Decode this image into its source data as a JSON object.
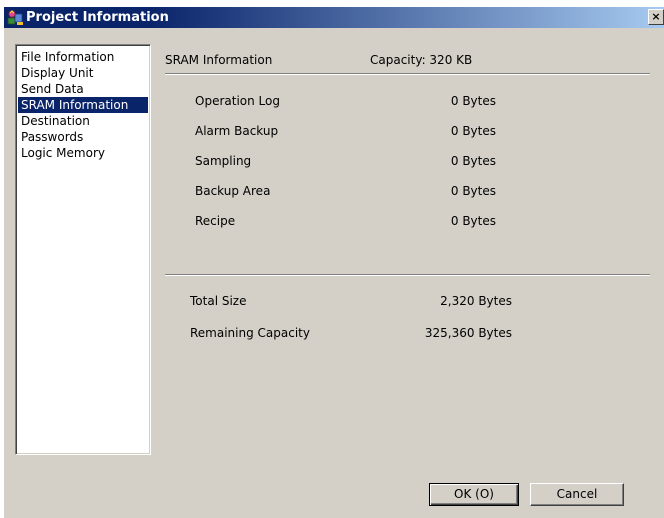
{
  "window": {
    "title": "Project Information",
    "close_label": "×"
  },
  "nav": {
    "items": [
      {
        "label": "File Information"
      },
      {
        "label": "Display Unit"
      },
      {
        "label": "Send Data"
      },
      {
        "label": "SRAM Information",
        "selected": true
      },
      {
        "label": "Destination"
      },
      {
        "label": "Passwords"
      },
      {
        "label": "Logic Memory"
      }
    ]
  },
  "panel": {
    "title": "SRAM Information",
    "capacity": "Capacity: 320 KB",
    "rows": [
      {
        "label": "Operation Log",
        "value": "0 Bytes"
      },
      {
        "label": "Alarm Backup",
        "value": "0 Bytes"
      },
      {
        "label": "Sampling",
        "value": "0 Bytes"
      },
      {
        "label": "Backup Area",
        "value": "0 Bytes"
      },
      {
        "label": "Recipe",
        "value": "0 Bytes"
      }
    ],
    "totals": [
      {
        "label": "Total Size",
        "value": "2,320 Bytes"
      },
      {
        "label": "Remaining Capacity",
        "value": "325,360 Bytes"
      }
    ]
  },
  "buttons": {
    "ok": "OK (O)",
    "cancel": "Cancel"
  },
  "icon": {
    "title_icon": "project-info-icon"
  }
}
